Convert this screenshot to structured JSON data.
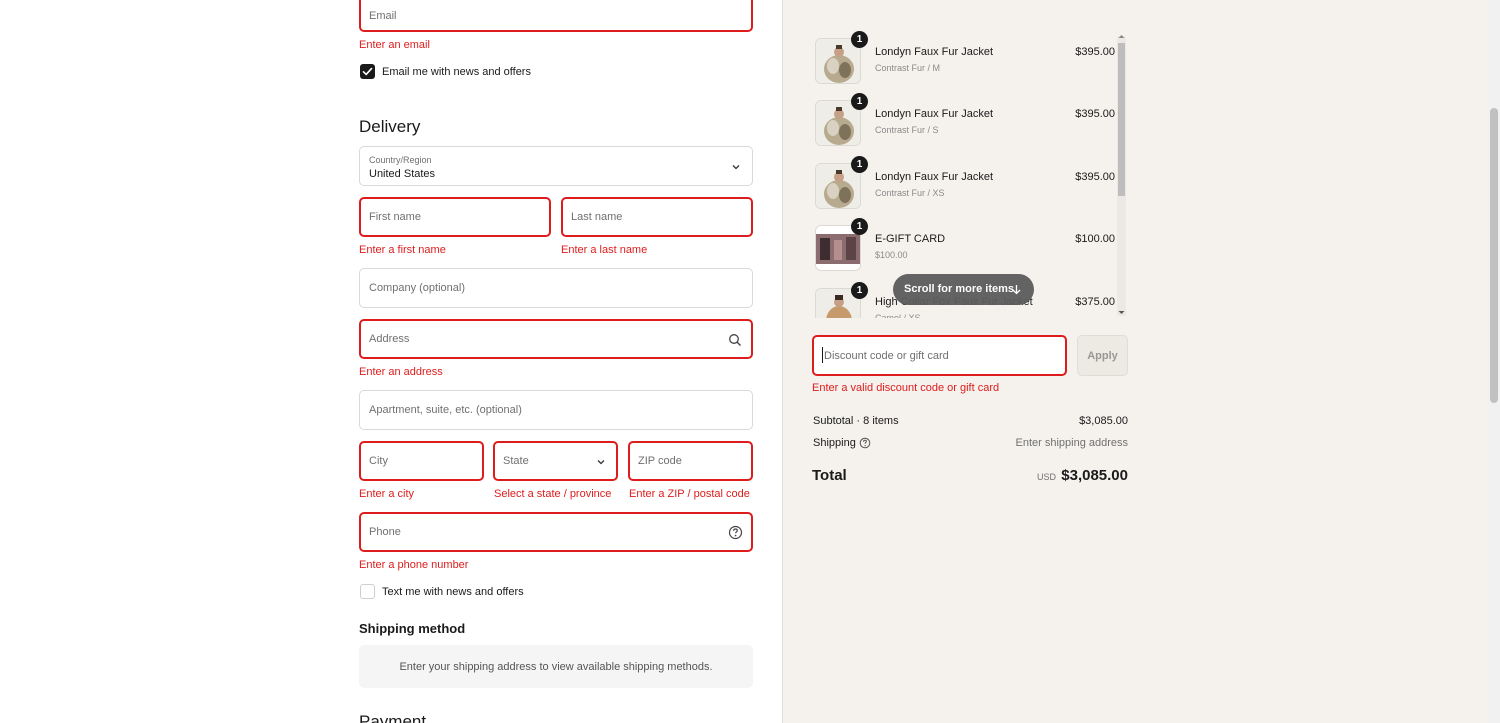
{
  "contact": {
    "email_placeholder": "Email",
    "email_error": "Enter an email",
    "email_optin_label": "Email me with news and offers",
    "email_optin_checked": true
  },
  "delivery": {
    "title": "Delivery",
    "country_label": "Country/Region",
    "country_value": "United States",
    "first_name_placeholder": "First name",
    "first_name_error": "Enter a first name",
    "last_name_placeholder": "Last name",
    "last_name_error": "Enter a last name",
    "company_placeholder": "Company (optional)",
    "address_placeholder": "Address",
    "address_error": "Enter an address",
    "apartment_placeholder": "Apartment, suite, etc. (optional)",
    "city_placeholder": "City",
    "city_error": "Enter a city",
    "state_placeholder": "State",
    "state_error": "Select a state / province",
    "zip_placeholder": "ZIP code",
    "zip_error": "Enter a ZIP / postal code",
    "phone_placeholder": "Phone",
    "phone_error": "Enter a phone number",
    "sms_optin_label": "Text me with news and offers",
    "sms_optin_checked": false
  },
  "shipping_method": {
    "title": "Shipping method",
    "placeholder_text": "Enter your shipping address to view available shipping methods."
  },
  "payment": {
    "title": "Payment"
  },
  "cart": {
    "items": [
      {
        "name": "Londyn Faux Fur Jacket",
        "variant": "Contrast Fur / M",
        "price": "$395.00",
        "qty": "1"
      },
      {
        "name": "Londyn Faux Fur Jacket",
        "variant": "Contrast Fur / S",
        "price": "$395.00",
        "qty": "1"
      },
      {
        "name": "Londyn Faux Fur Jacket",
        "variant": "Contrast Fur / XS",
        "price": "$395.00",
        "qty": "1"
      },
      {
        "name": "E-GIFT CARD",
        "variant": "$100.00",
        "price": "$100.00",
        "qty": "1"
      },
      {
        "name": "High Collar Fox Faux Fur Jacket",
        "variant": "Camel / XS",
        "price": "$375.00",
        "qty": "1"
      }
    ],
    "scroll_hint": "Scroll for more items"
  },
  "discount": {
    "placeholder": "Discount code or gift card",
    "apply_label": "Apply",
    "error": "Enter a valid discount code or gift card"
  },
  "summary": {
    "subtotal_label": "Subtotal · 8 items",
    "subtotal_value": "$3,085.00",
    "shipping_label": "Shipping",
    "shipping_value": "Enter shipping address",
    "total_label": "Total",
    "currency": "USD",
    "total_value": "$3,085.00"
  },
  "colors": {
    "error": "#dd1d1d",
    "summary_bg": "#f5f2ee",
    "text": "#1a1a1a"
  }
}
